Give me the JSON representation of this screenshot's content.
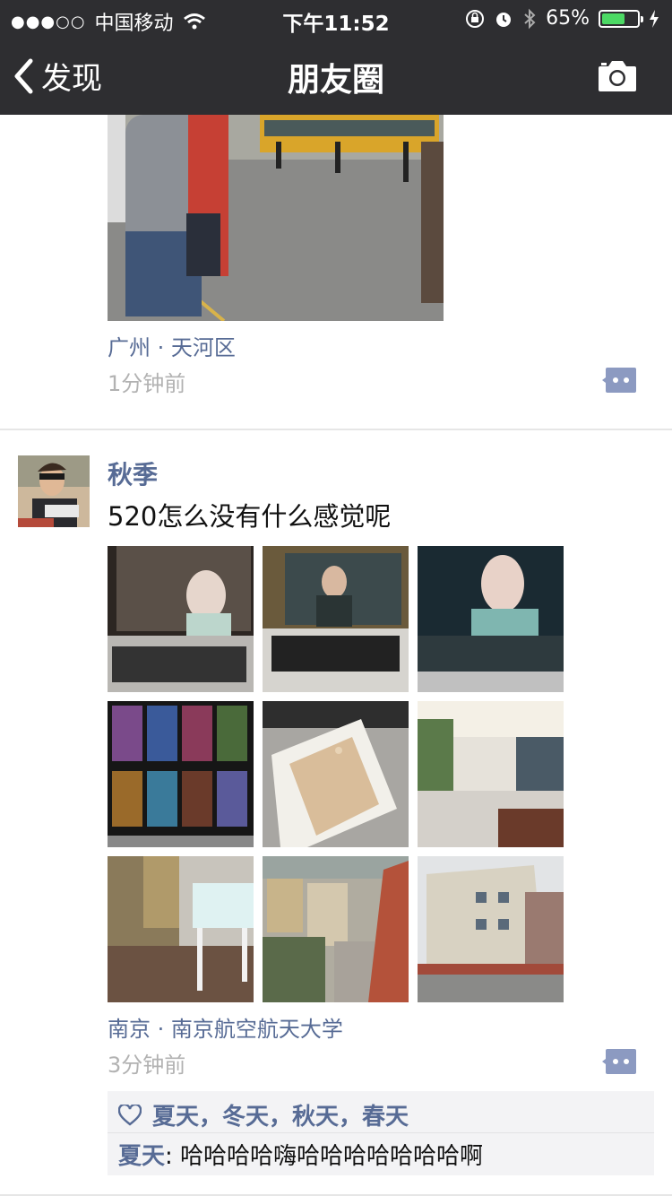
{
  "status_bar": {
    "signal": "●●●○○",
    "carrier": "中国移动",
    "time": "下午11:52",
    "battery_percent": "65%",
    "battery_level": 0.65
  },
  "nav": {
    "back_label": "发现",
    "title": "朋友圈"
  },
  "post1": {
    "location": "广州 · 天河区",
    "time": "1分钟前"
  },
  "post2": {
    "author": "秋季",
    "text": "520怎么没有什么感觉呢",
    "location": "南京 · 南京航空航天大学",
    "time": "3分钟前",
    "likes": "夏天，冬天，秋天，春天",
    "comment": {
      "name": "夏天",
      "separator": ": ",
      "text": "哈哈哈哈嗨哈哈哈哈哈哈哈啊"
    }
  },
  "colors": {
    "bar_bg": "#2e2e31",
    "link": "#576b95",
    "meta_grey": "#b2b2b2",
    "battery_green": "#4cd964"
  }
}
